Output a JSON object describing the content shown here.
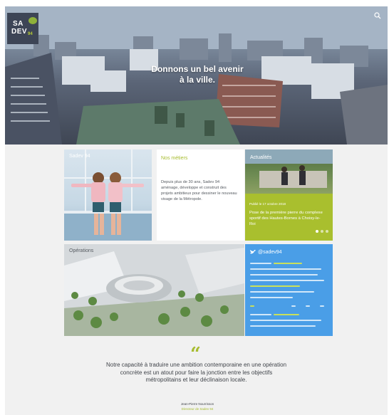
{
  "logo": {
    "line1": "SA",
    "line2": "DEV",
    "line3": "94"
  },
  "hero": {
    "title_line1": "Donnons un bel avenir",
    "title_line2": "à la ville."
  },
  "cards": {
    "sadev": {
      "kicker": "Sadev 94"
    },
    "metiers": {
      "heading": "Nos métiers",
      "body": "Depuis plus de 30 ans, Sadev 94 aménage, développe et construit des projets ambitieux pour dessiner le nouveau visage de la Métropole."
    },
    "actualites": {
      "kicker": "Actualités",
      "date": "Publié le 17 octobre 2018",
      "headline": "Pose de la première pierre du complexe sportif des Hautes-Bornes à Choisy-le-Roi"
    },
    "operations": {
      "kicker": "Opérations"
    },
    "twitter": {
      "handle": "@sadev94"
    }
  },
  "quote": {
    "text": "Notre capacité à traduire une ambition contemporaine en une opération concrète est un atout pour faire la jonction entre les objectifs métropolitains et leur déclinaison locale.",
    "author": "Jean-Pierre Nourrisson",
    "role": "Directeur de Sadev 94"
  },
  "colors": {
    "accent": "#a7bc2f",
    "twitter": "#4a9ee7",
    "logo_bg": "#3d4556"
  },
  "icons": {
    "search": "search-icon",
    "twitter": "twitter-bird-icon",
    "quote": "quote-icon"
  }
}
